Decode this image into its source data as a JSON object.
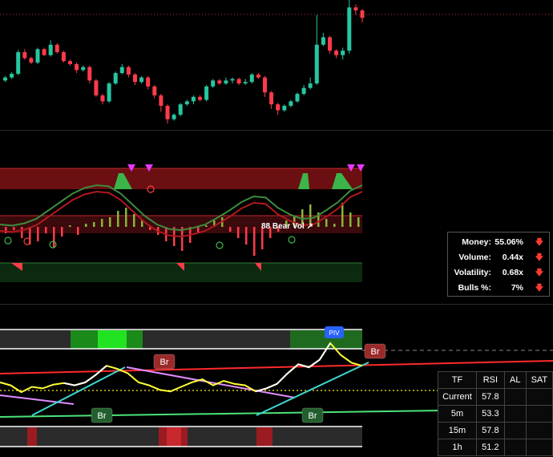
{
  "chart_data": [
    {
      "type": "candlestick",
      "panel": "price",
      "note": "Candlestick price panel; values estimated in pixel-free relative units",
      "candles": [
        {
          "o": 62,
          "c": 66,
          "h": 68,
          "l": 60,
          "up": false
        },
        {
          "o": 66,
          "c": 71,
          "h": 73,
          "l": 64,
          "up": false
        },
        {
          "o": 71,
          "c": 100,
          "h": 103,
          "l": 69,
          "up": false
        },
        {
          "o": 100,
          "c": 92,
          "h": 104,
          "l": 90,
          "up": true
        },
        {
          "o": 92,
          "c": 86,
          "h": 94,
          "l": 84,
          "up": true
        },
        {
          "o": 86,
          "c": 104,
          "h": 106,
          "l": 84,
          "up": false
        },
        {
          "o": 104,
          "c": 96,
          "h": 106,
          "l": 95,
          "up": true
        },
        {
          "o": 96,
          "c": 110,
          "h": 116,
          "l": 94,
          "up": false
        },
        {
          "o": 110,
          "c": 100,
          "h": 112,
          "l": 98,
          "up": true
        },
        {
          "o": 100,
          "c": 88,
          "h": 102,
          "l": 86,
          "up": true
        },
        {
          "o": 88,
          "c": 84,
          "h": 90,
          "l": 82,
          "up": true
        },
        {
          "o": 84,
          "c": 76,
          "h": 86,
          "l": 72,
          "up": true
        },
        {
          "o": 76,
          "c": 80,
          "h": 82,
          "l": 74,
          "up": false
        },
        {
          "o": 80,
          "c": 62,
          "h": 82,
          "l": 58,
          "up": true
        },
        {
          "o": 62,
          "c": 42,
          "h": 64,
          "l": 40,
          "up": true
        },
        {
          "o": 42,
          "c": 34,
          "h": 44,
          "l": 30,
          "up": true
        },
        {
          "o": 34,
          "c": 58,
          "h": 60,
          "l": 32,
          "up": false
        },
        {
          "o": 58,
          "c": 72,
          "h": 74,
          "l": 56,
          "up": false
        },
        {
          "o": 72,
          "c": 80,
          "h": 84,
          "l": 70,
          "up": false
        },
        {
          "o": 80,
          "c": 70,
          "h": 82,
          "l": 66,
          "up": true
        },
        {
          "o": 70,
          "c": 60,
          "h": 72,
          "l": 56,
          "up": true
        },
        {
          "o": 60,
          "c": 66,
          "h": 68,
          "l": 58,
          "up": false
        },
        {
          "o": 66,
          "c": 54,
          "h": 68,
          "l": 50,
          "up": true
        },
        {
          "o": 54,
          "c": 42,
          "h": 56,
          "l": 38,
          "up": true
        },
        {
          "o": 42,
          "c": 28,
          "h": 44,
          "l": 20,
          "up": true
        },
        {
          "o": 28,
          "c": 10,
          "h": 30,
          "l": 4,
          "up": true
        },
        {
          "o": 10,
          "c": 16,
          "h": 18,
          "l": 8,
          "up": false
        },
        {
          "o": 16,
          "c": 30,
          "h": 32,
          "l": 14,
          "up": false
        },
        {
          "o": 30,
          "c": 34,
          "h": 36,
          "l": 28,
          "up": false
        },
        {
          "o": 34,
          "c": 40,
          "h": 42,
          "l": 30,
          "up": false
        },
        {
          "o": 40,
          "c": 36,
          "h": 42,
          "l": 34,
          "up": true
        },
        {
          "o": 36,
          "c": 54,
          "h": 56,
          "l": 34,
          "up": false
        },
        {
          "o": 54,
          "c": 62,
          "h": 64,
          "l": 52,
          "up": false
        },
        {
          "o": 62,
          "c": 58,
          "h": 64,
          "l": 56,
          "up": true
        },
        {
          "o": 58,
          "c": 62,
          "h": 66,
          "l": 56,
          "up": false
        },
        {
          "o": 62,
          "c": 64,
          "h": 66,
          "l": 58,
          "up": false
        },
        {
          "o": 64,
          "c": 58,
          "h": 66,
          "l": 56,
          "up": true
        },
        {
          "o": 58,
          "c": 60,
          "h": 64,
          "l": 56,
          "up": false
        },
        {
          "o": 60,
          "c": 70,
          "h": 72,
          "l": 58,
          "up": false
        },
        {
          "o": 70,
          "c": 66,
          "h": 72,
          "l": 64,
          "up": true
        },
        {
          "o": 66,
          "c": 46,
          "h": 68,
          "l": 40,
          "up": true
        },
        {
          "o": 46,
          "c": 30,
          "h": 48,
          "l": 24,
          "up": true
        },
        {
          "o": 30,
          "c": 22,
          "h": 32,
          "l": 16,
          "up": true
        },
        {
          "o": 22,
          "c": 28,
          "h": 30,
          "l": 20,
          "up": false
        },
        {
          "o": 28,
          "c": 34,
          "h": 36,
          "l": 26,
          "up": false
        },
        {
          "o": 34,
          "c": 44,
          "h": 46,
          "l": 32,
          "up": false
        },
        {
          "o": 44,
          "c": 52,
          "h": 56,
          "l": 42,
          "up": false
        },
        {
          "o": 52,
          "c": 58,
          "h": 66,
          "l": 50,
          "up": false
        },
        {
          "o": 58,
          "c": 110,
          "h": 150,
          "l": 56,
          "up": false
        },
        {
          "o": 110,
          "c": 120,
          "h": 126,
          "l": 108,
          "up": false
        },
        {
          "o": 120,
          "c": 102,
          "h": 122,
          "l": 98,
          "up": true
        },
        {
          "o": 102,
          "c": 96,
          "h": 104,
          "l": 92,
          "up": true
        },
        {
          "o": 96,
          "c": 102,
          "h": 106,
          "l": 90,
          "up": false
        },
        {
          "o": 102,
          "c": 160,
          "h": 170,
          "l": 98,
          "up": false
        },
        {
          "o": 160,
          "c": 156,
          "h": 164,
          "l": 150,
          "up": true
        },
        {
          "o": 156,
          "c": 146,
          "h": 158,
          "l": 140,
          "up": true
        }
      ]
    },
    {
      "type": "line",
      "panel": "oscillator",
      "label": "88 Bear Vol ↗",
      "series": [
        {
          "name": "",
          "values": [
            30,
            28,
            32,
            40,
            55,
            70,
            85,
            95,
            100,
            98,
            85,
            65,
            45,
            30,
            22,
            20,
            24,
            30,
            42,
            55,
            70,
            80,
            78,
            60,
            48,
            40,
            42,
            55,
            70,
            90,
            100
          ]
        }
      ]
    },
    {
      "type": "line",
      "panel": "rsi",
      "series": [
        {
          "name": "",
          "values": [
            48,
            44,
            35,
            42,
            40,
            45,
            47,
            44,
            48,
            58,
            70,
            66,
            60,
            48,
            44,
            38,
            36,
            42,
            48,
            52,
            44,
            50,
            46,
            44,
            36,
            40,
            46,
            60,
            72,
            68,
            78,
            100,
            84,
            74,
            70
          ]
        }
      ]
    }
  ],
  "labels": {
    "oscillator_text": "88 Bear Vol ↗",
    "piv": "PIV",
    "br_top": "Br",
    "br_left": "Br",
    "br_right": "Br",
    "br_edge": "Br"
  },
  "stats": [
    {
      "label": "Money:",
      "value": "55.06%"
    },
    {
      "label": "Volume:",
      "value": "0.44x"
    },
    {
      "label": "Volatility:",
      "value": "0.68x"
    },
    {
      "label": "Bulls %:",
      "value": "7%"
    }
  ],
  "tf_table": {
    "headers": [
      "TF",
      "RSI",
      "AL",
      "SAT"
    ],
    "rows": [
      {
        "tf": "Current",
        "rsi": "57.8",
        "al": "",
        "sat": ""
      },
      {
        "tf": "5m",
        "rsi": "53.3",
        "al": "",
        "sat": ""
      },
      {
        "tf": "15m",
        "rsi": "57.8",
        "al": "",
        "sat": ""
      },
      {
        "tf": "1h",
        "rsi": "51.2",
        "al": "",
        "sat": ""
      }
    ]
  },
  "colors": {
    "up": "#ff3b4a",
    "down": "#26c6a0",
    "bear_fill": "#6b0f12",
    "bull_fill": "#3bb54a",
    "rsi": "#ffff33",
    "white_line": "#ffffff",
    "cyan": "#3fd6d0",
    "pink": "#e08cff",
    "red_line": "#ff2a2a",
    "green_line": "#4be37a",
    "magenta_tri": "#e838ff",
    "piv": "#2962ff"
  },
  "arrow_icon": "down-arrow-icon"
}
